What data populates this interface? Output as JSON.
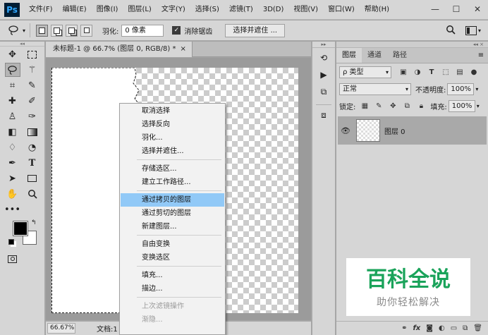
{
  "app": {
    "logo": "Ps"
  },
  "menubar": {
    "items": [
      "文件(F)",
      "编辑(E)",
      "图像(I)",
      "图层(L)",
      "文字(Y)",
      "选择(S)",
      "滤镜(T)",
      "3D(D)",
      "视图(V)",
      "窗口(W)",
      "帮助(H)"
    ],
    "window_controls": {
      "minimize": "—",
      "maximize": "☐",
      "close": "✕"
    }
  },
  "options": {
    "tool_icon": "lasso-icon",
    "feather_label": "羽化:",
    "feather_value": "0 像素",
    "antialias_checked": true,
    "antialias_label": "消除锯齿",
    "select_mask_label": "选择并遮住 ...",
    "search_icon": "search-icon",
    "workspace_icon": "workspace-icon"
  },
  "document": {
    "tab_title": "未标题-1 @ 66.7% (图层 0, RGB/8) *",
    "tab_close": "×",
    "zoom": "66.67%",
    "status": "文档:1"
  },
  "context_menu": {
    "items": [
      {
        "label": "取消选择"
      },
      {
        "label": "选择反向"
      },
      {
        "label": "羽化..."
      },
      {
        "label": "选择并遮住..."
      },
      {
        "label": "存储选区..."
      },
      {
        "label": "建立工作路径..."
      },
      {
        "label": "通过拷贝的图层"
      },
      {
        "label": "通过剪切的图层"
      },
      {
        "label": "新建图层..."
      },
      {
        "label": "自由变换"
      },
      {
        "label": "变换选区"
      },
      {
        "label": "填充..."
      },
      {
        "label": "描边..."
      },
      {
        "label": "上次滤镜操作"
      },
      {
        "label": "渐隐..."
      }
    ],
    "highlighted_index": 6,
    "disabled_indices": [
      13,
      14
    ]
  },
  "layers_panel": {
    "tabs": [
      "图层",
      "通道",
      "路径"
    ],
    "active_tab": "图层",
    "filter_kind": "ρ 类型",
    "blend_mode": "正常",
    "opacity_label": "不透明度:",
    "opacity_value": "100%",
    "lock_label": "锁定:",
    "fill_label": "填充:",
    "fill_value": "100%",
    "layers": [
      {
        "name": "图层 0",
        "visible": true
      }
    ],
    "footer_icons": [
      "link-icon",
      "fx-icon",
      "mask-icon",
      "adjustment-icon",
      "group-icon",
      "new-layer-icon",
      "trash-icon"
    ]
  },
  "watermark": {
    "title": "百科全说",
    "subtitle": "助你轻松解决"
  },
  "colors": {
    "chrome": "#d6d6d6",
    "highlight": "#91c9f7",
    "watermark_green": "#1aa35a",
    "ps_blue": "#31a8ff"
  }
}
